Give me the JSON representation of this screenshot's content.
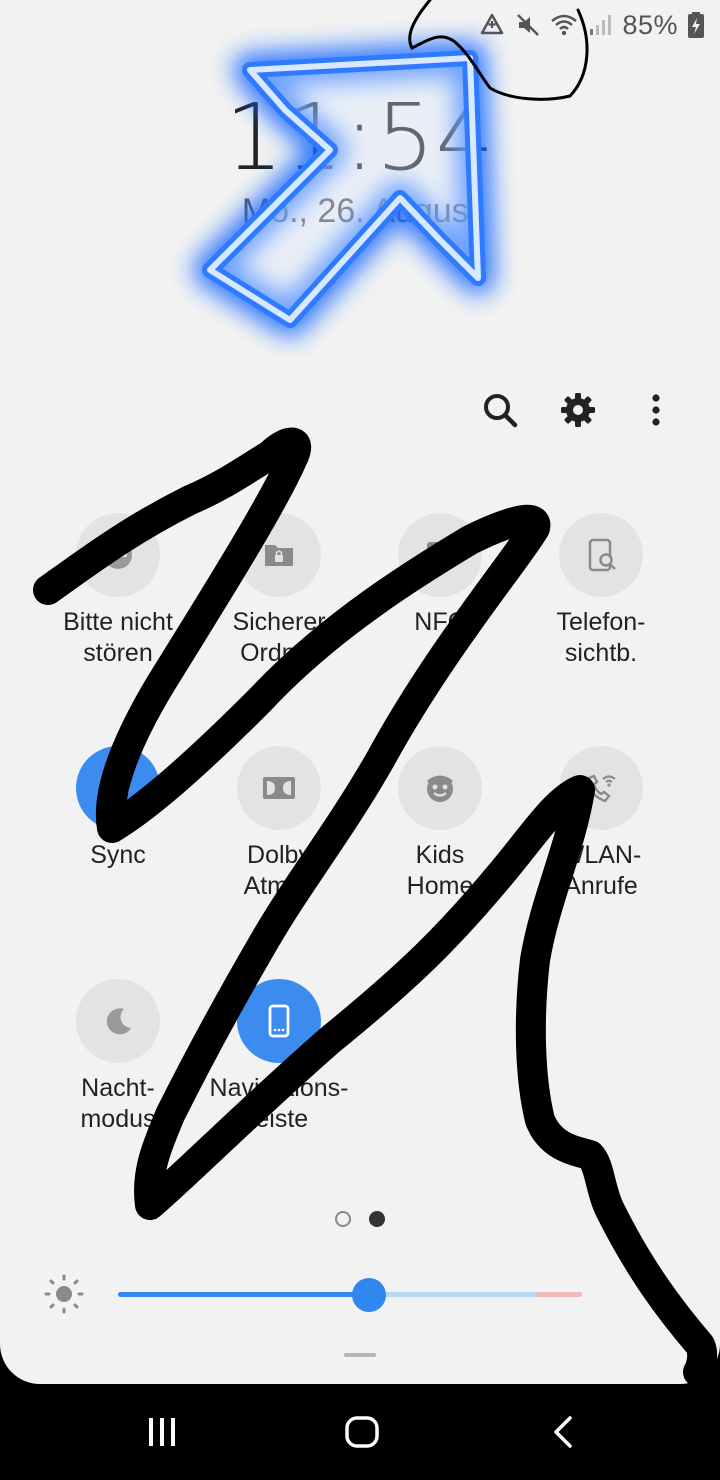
{
  "status_bar": {
    "icons": [
      "data-saver-icon",
      "mute-icon",
      "wifi-icon",
      "signal-icon"
    ],
    "battery_percent": "85%",
    "battery_icon": "battery-charging-icon"
  },
  "lock": {
    "time": "11:54",
    "date": "Mo., 26. August"
  },
  "header": {
    "search_icon": "search-icon",
    "settings_icon": "gear-icon",
    "more_icon": "more-vertical-icon"
  },
  "tiles": [
    {
      "label": "Bitte nicht\nstören",
      "icon": "do-not-disturb-icon",
      "active": false
    },
    {
      "label": "Sicherer\nOrdner",
      "icon": "secure-folder-icon",
      "active": false
    },
    {
      "label": "NFC",
      "icon": "nfc-icon",
      "active": false
    },
    {
      "label": "Telefon-\nsichtb.",
      "icon": "phone-visibility-icon",
      "active": false
    },
    {
      "label": "Sync",
      "icon": "sync-icon",
      "active": true
    },
    {
      "label": "Dolby\nAtmos",
      "icon": "dolby-icon",
      "active": false
    },
    {
      "label": "Kids\nHome",
      "icon": "kids-home-icon",
      "active": false
    },
    {
      "label": "WLAN-\nAnrufe",
      "icon": "wifi-calling-icon",
      "active": false
    },
    {
      "label": "Nacht-\nmodus",
      "icon": "night-mode-icon",
      "active": false
    },
    {
      "label": "Navigations-\nleiste",
      "icon": "navigation-bar-icon",
      "active": true
    }
  ],
  "pages": {
    "count": 2,
    "current": 2
  },
  "brightness": {
    "level": 0.54,
    "icon": "brightness-icon"
  },
  "nav": {
    "recents_icon": "recents-icon",
    "home_icon": "home-icon",
    "back_icon": "back-icon"
  },
  "colors": {
    "panel_bg": "#f2f2f2",
    "accent": "#3c8cf0",
    "tile_off": "#e3e3e3",
    "annotation_arrow": "#1e6cff",
    "scribble": "#000000"
  }
}
